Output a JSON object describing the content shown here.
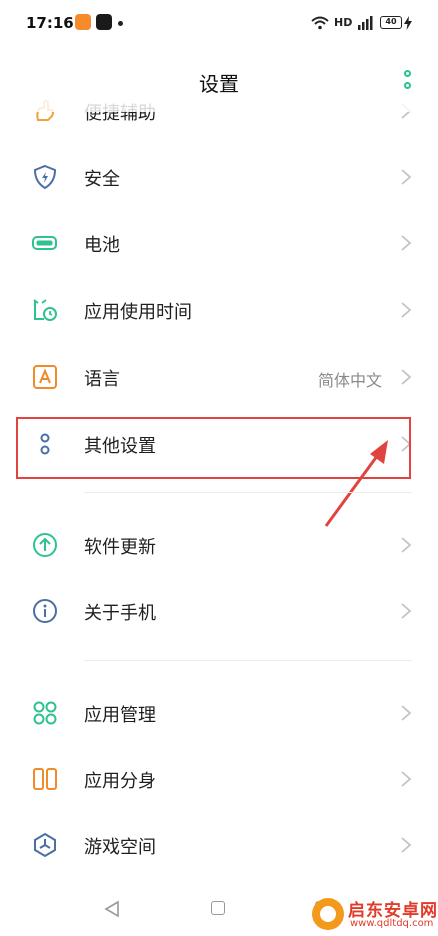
{
  "status_bar": {
    "time": "17:16",
    "network": "HD",
    "battery": "40"
  },
  "header": {
    "title": "设置",
    "menu_icon": "more-vertical-icon"
  },
  "settings": {
    "items": [
      {
        "label": "便捷辅助",
        "icon": "hand-icon",
        "value": ""
      },
      {
        "label": "安全",
        "icon": "shield-icon",
        "value": ""
      },
      {
        "label": "电池",
        "icon": "battery-icon",
        "value": ""
      },
      {
        "label": "应用使用时间",
        "icon": "alarm-clock-icon",
        "value": ""
      },
      {
        "label": "语言",
        "icon": "language-icon",
        "value": "简体中文"
      },
      {
        "label": "其他设置",
        "icon": "more-icon",
        "value": ""
      },
      {
        "label": "软件更新",
        "icon": "update-icon",
        "value": ""
      },
      {
        "label": "关于手机",
        "icon": "info-icon",
        "value": ""
      },
      {
        "label": "应用管理",
        "icon": "apps-icon",
        "value": ""
      },
      {
        "label": "应用分身",
        "icon": "clone-icon",
        "value": ""
      },
      {
        "label": "游戏空间",
        "icon": "game-icon",
        "value": ""
      }
    ]
  },
  "watermark": {
    "name": "启东安卓网",
    "url": "www.qdltdq.com"
  },
  "colors": {
    "accent": "#2ec28e",
    "highlight": "#e0443f",
    "icon_blue": "#4a6fa5"
  }
}
